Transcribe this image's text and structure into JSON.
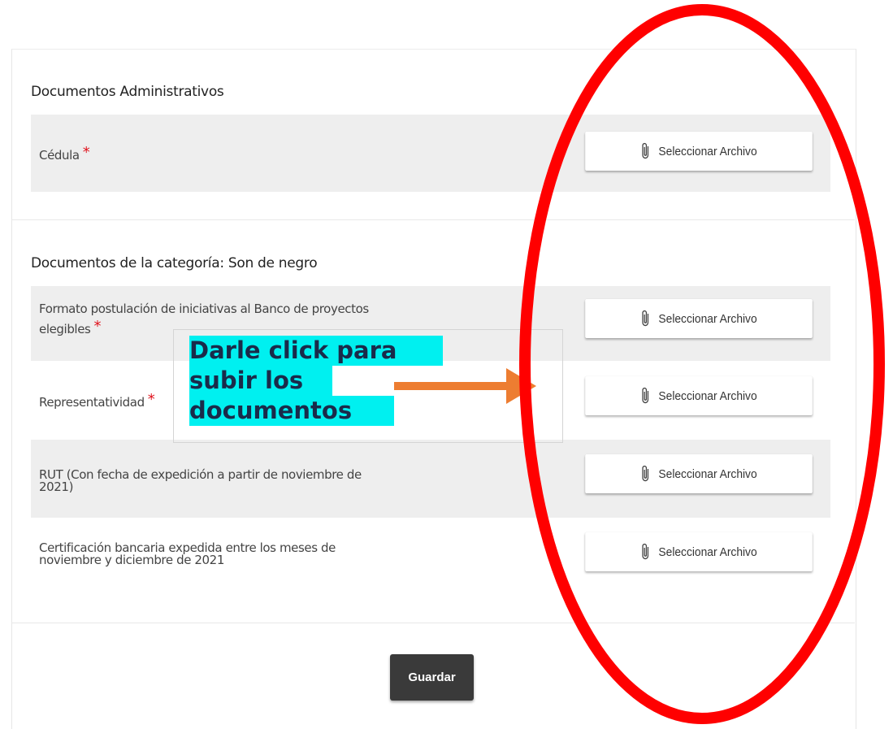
{
  "sections": [
    {
      "title": "Documentos Administrativos",
      "rows": [
        {
          "label": "Cédula",
          "required_mark": "*",
          "button_label": "Seleccionar Archivo",
          "icon": "paperclip-icon"
        }
      ]
    },
    {
      "title": "Documentos de la categoría: Son de negro",
      "rows": [
        {
          "label_line1": "Formato postulación de iniciativas al Banco de proyectos",
          "label_line2": "elegibles",
          "required_mark": "*",
          "button_label": "Seleccionar Archivo",
          "icon": "paperclip-icon"
        },
        {
          "label": "Representatividad",
          "required_mark": "*",
          "button_label": "Seleccionar Archivo",
          "icon": "paperclip-icon"
        },
        {
          "label_line1": "RUT (Con fecha de expedición a partir de noviembre de",
          "label_line2": "2021)",
          "button_label": "Seleccionar Archivo",
          "icon": "paperclip-icon"
        },
        {
          "label_line1": "Certificación bancaria expedida entre los meses de",
          "label_line2": "noviembre y diciembre de 2021",
          "button_label": "Seleccionar Archivo",
          "icon": "paperclip-icon"
        }
      ]
    }
  ],
  "save_label": "Guardar",
  "annotation": {
    "line1": "Darle click para",
    "line2": "subir los",
    "line3": "documentos",
    "highlight_color": "#00f0f0",
    "arrow_color": "#ed7d31",
    "ellipse_color": "#ff0000"
  }
}
